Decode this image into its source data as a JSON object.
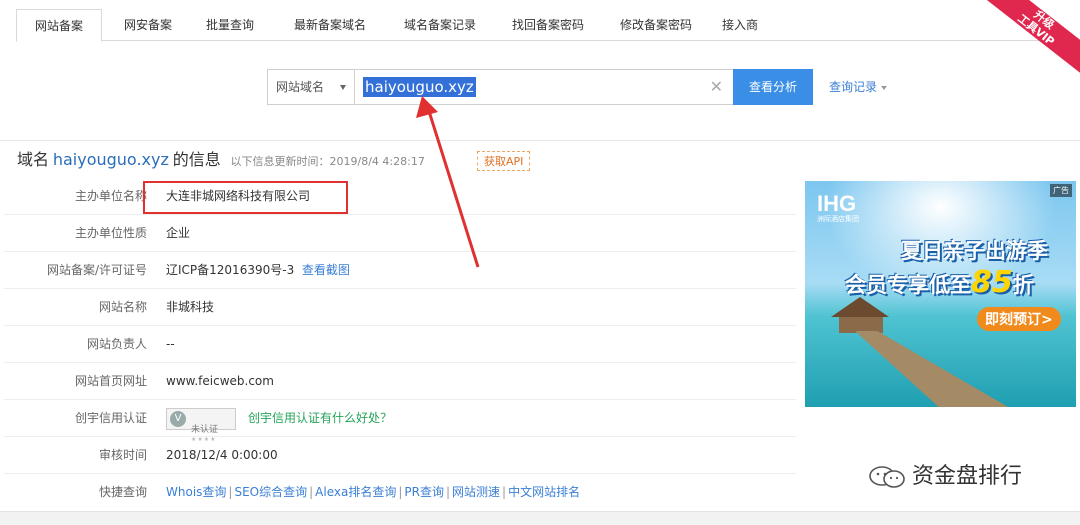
{
  "tabs": [
    {
      "label": "网站备案"
    },
    {
      "label": "网安备案"
    },
    {
      "label": "批量查询"
    },
    {
      "label": "最新备案域名"
    },
    {
      "label": "域名备案记录"
    },
    {
      "label": "找回备案密码"
    },
    {
      "label": "修改备案密码"
    },
    {
      "label": "接入商"
    }
  ],
  "vip_ribbon": {
    "line1": "升级",
    "line2": "工具VIP"
  },
  "search": {
    "type_label": "网站域名",
    "value": "haiyouguo.xyz",
    "submit_label": "查看分析",
    "history_label": "查询记录"
  },
  "info": {
    "prefix": "域名",
    "domain": "haiyouguo.xyz",
    "suffix": "的信息",
    "update_text": "以下信息更新时间：2019/8/4 4:28:17",
    "api_label": "获取API"
  },
  "rows": {
    "org_name": {
      "label": "主办单位名称",
      "value": "大连非城网络科技有限公司"
    },
    "org_type": {
      "label": "主办单位性质",
      "value": "企业"
    },
    "license": {
      "label": "网站备案/许可证号",
      "value": "辽ICP备12016390号-3",
      "link": "查看截图"
    },
    "site_name": {
      "label": "网站名称",
      "value": "非城科技"
    },
    "owner": {
      "label": "网站负责人",
      "value": "--"
    },
    "homepage": {
      "label": "网站首页网址",
      "value": "www.feicweb.com"
    },
    "credit": {
      "label": "创宇信用认证",
      "badge_text": "未认证",
      "link": "创宇信用认证有什么好处？"
    },
    "audit_time": {
      "label": "审核时间",
      "value": "2018/12/4 0:00:00"
    },
    "quick": {
      "label": "快捷查询",
      "links": [
        "Whois查询",
        "SEO综合查询",
        "Alexa排名查询",
        "PR查询",
        "网站测速",
        "中文网站排名"
      ]
    }
  },
  "ad": {
    "tag": "广告",
    "logo": "IHG",
    "logo_sub": "洲际酒店集团",
    "headline1": "夏日亲子出游季",
    "headline2_prefix": "会员专享低至",
    "headline2_num": "85",
    "headline2_suffix": "折",
    "cta": "即刻预订>"
  },
  "watermark": "资金盘排行",
  "colors": {
    "accent": "#3a8ee6",
    "link": "#3a7fd5",
    "highlight_box": "#e03030",
    "ribbon": "#e0284f"
  }
}
